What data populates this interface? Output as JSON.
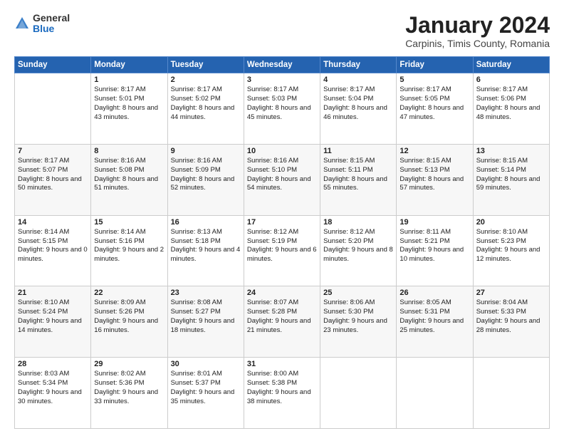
{
  "header": {
    "logo_general": "General",
    "logo_blue": "Blue",
    "month_title": "January 2024",
    "location": "Carpinis, Timis County, Romania"
  },
  "days_of_week": [
    "Sunday",
    "Monday",
    "Tuesday",
    "Wednesday",
    "Thursday",
    "Friday",
    "Saturday"
  ],
  "weeks": [
    [
      {
        "day": "",
        "sunrise": "",
        "sunset": "",
        "daylight": ""
      },
      {
        "day": "1",
        "sunrise": "Sunrise: 8:17 AM",
        "sunset": "Sunset: 5:01 PM",
        "daylight": "Daylight: 8 hours and 43 minutes."
      },
      {
        "day": "2",
        "sunrise": "Sunrise: 8:17 AM",
        "sunset": "Sunset: 5:02 PM",
        "daylight": "Daylight: 8 hours and 44 minutes."
      },
      {
        "day": "3",
        "sunrise": "Sunrise: 8:17 AM",
        "sunset": "Sunset: 5:03 PM",
        "daylight": "Daylight: 8 hours and 45 minutes."
      },
      {
        "day": "4",
        "sunrise": "Sunrise: 8:17 AM",
        "sunset": "Sunset: 5:04 PM",
        "daylight": "Daylight: 8 hours and 46 minutes."
      },
      {
        "day": "5",
        "sunrise": "Sunrise: 8:17 AM",
        "sunset": "Sunset: 5:05 PM",
        "daylight": "Daylight: 8 hours and 47 minutes."
      },
      {
        "day": "6",
        "sunrise": "Sunrise: 8:17 AM",
        "sunset": "Sunset: 5:06 PM",
        "daylight": "Daylight: 8 hours and 48 minutes."
      }
    ],
    [
      {
        "day": "7",
        "sunrise": "Sunrise: 8:17 AM",
        "sunset": "Sunset: 5:07 PM",
        "daylight": "Daylight: 8 hours and 50 minutes."
      },
      {
        "day": "8",
        "sunrise": "Sunrise: 8:16 AM",
        "sunset": "Sunset: 5:08 PM",
        "daylight": "Daylight: 8 hours and 51 minutes."
      },
      {
        "day": "9",
        "sunrise": "Sunrise: 8:16 AM",
        "sunset": "Sunset: 5:09 PM",
        "daylight": "Daylight: 8 hours and 52 minutes."
      },
      {
        "day": "10",
        "sunrise": "Sunrise: 8:16 AM",
        "sunset": "Sunset: 5:10 PM",
        "daylight": "Daylight: 8 hours and 54 minutes."
      },
      {
        "day": "11",
        "sunrise": "Sunrise: 8:15 AM",
        "sunset": "Sunset: 5:11 PM",
        "daylight": "Daylight: 8 hours and 55 minutes."
      },
      {
        "day": "12",
        "sunrise": "Sunrise: 8:15 AM",
        "sunset": "Sunset: 5:13 PM",
        "daylight": "Daylight: 8 hours and 57 minutes."
      },
      {
        "day": "13",
        "sunrise": "Sunrise: 8:15 AM",
        "sunset": "Sunset: 5:14 PM",
        "daylight": "Daylight: 8 hours and 59 minutes."
      }
    ],
    [
      {
        "day": "14",
        "sunrise": "Sunrise: 8:14 AM",
        "sunset": "Sunset: 5:15 PM",
        "daylight": "Daylight: 9 hours and 0 minutes."
      },
      {
        "day": "15",
        "sunrise": "Sunrise: 8:14 AM",
        "sunset": "Sunset: 5:16 PM",
        "daylight": "Daylight: 9 hours and 2 minutes."
      },
      {
        "day": "16",
        "sunrise": "Sunrise: 8:13 AM",
        "sunset": "Sunset: 5:18 PM",
        "daylight": "Daylight: 9 hours and 4 minutes."
      },
      {
        "day": "17",
        "sunrise": "Sunrise: 8:12 AM",
        "sunset": "Sunset: 5:19 PM",
        "daylight": "Daylight: 9 hours and 6 minutes."
      },
      {
        "day": "18",
        "sunrise": "Sunrise: 8:12 AM",
        "sunset": "Sunset: 5:20 PM",
        "daylight": "Daylight: 9 hours and 8 minutes."
      },
      {
        "day": "19",
        "sunrise": "Sunrise: 8:11 AM",
        "sunset": "Sunset: 5:21 PM",
        "daylight": "Daylight: 9 hours and 10 minutes."
      },
      {
        "day": "20",
        "sunrise": "Sunrise: 8:10 AM",
        "sunset": "Sunset: 5:23 PM",
        "daylight": "Daylight: 9 hours and 12 minutes."
      }
    ],
    [
      {
        "day": "21",
        "sunrise": "Sunrise: 8:10 AM",
        "sunset": "Sunset: 5:24 PM",
        "daylight": "Daylight: 9 hours and 14 minutes."
      },
      {
        "day": "22",
        "sunrise": "Sunrise: 8:09 AM",
        "sunset": "Sunset: 5:26 PM",
        "daylight": "Daylight: 9 hours and 16 minutes."
      },
      {
        "day": "23",
        "sunrise": "Sunrise: 8:08 AM",
        "sunset": "Sunset: 5:27 PM",
        "daylight": "Daylight: 9 hours and 18 minutes."
      },
      {
        "day": "24",
        "sunrise": "Sunrise: 8:07 AM",
        "sunset": "Sunset: 5:28 PM",
        "daylight": "Daylight: 9 hours and 21 minutes."
      },
      {
        "day": "25",
        "sunrise": "Sunrise: 8:06 AM",
        "sunset": "Sunset: 5:30 PM",
        "daylight": "Daylight: 9 hours and 23 minutes."
      },
      {
        "day": "26",
        "sunrise": "Sunrise: 8:05 AM",
        "sunset": "Sunset: 5:31 PM",
        "daylight": "Daylight: 9 hours and 25 minutes."
      },
      {
        "day": "27",
        "sunrise": "Sunrise: 8:04 AM",
        "sunset": "Sunset: 5:33 PM",
        "daylight": "Daylight: 9 hours and 28 minutes."
      }
    ],
    [
      {
        "day": "28",
        "sunrise": "Sunrise: 8:03 AM",
        "sunset": "Sunset: 5:34 PM",
        "daylight": "Daylight: 9 hours and 30 minutes."
      },
      {
        "day": "29",
        "sunrise": "Sunrise: 8:02 AM",
        "sunset": "Sunset: 5:36 PM",
        "daylight": "Daylight: 9 hours and 33 minutes."
      },
      {
        "day": "30",
        "sunrise": "Sunrise: 8:01 AM",
        "sunset": "Sunset: 5:37 PM",
        "daylight": "Daylight: 9 hours and 35 minutes."
      },
      {
        "day": "31",
        "sunrise": "Sunrise: 8:00 AM",
        "sunset": "Sunset: 5:38 PM",
        "daylight": "Daylight: 9 hours and 38 minutes."
      },
      {
        "day": "",
        "sunrise": "",
        "sunset": "",
        "daylight": ""
      },
      {
        "day": "",
        "sunrise": "",
        "sunset": "",
        "daylight": ""
      },
      {
        "day": "",
        "sunrise": "",
        "sunset": "",
        "daylight": ""
      }
    ]
  ]
}
